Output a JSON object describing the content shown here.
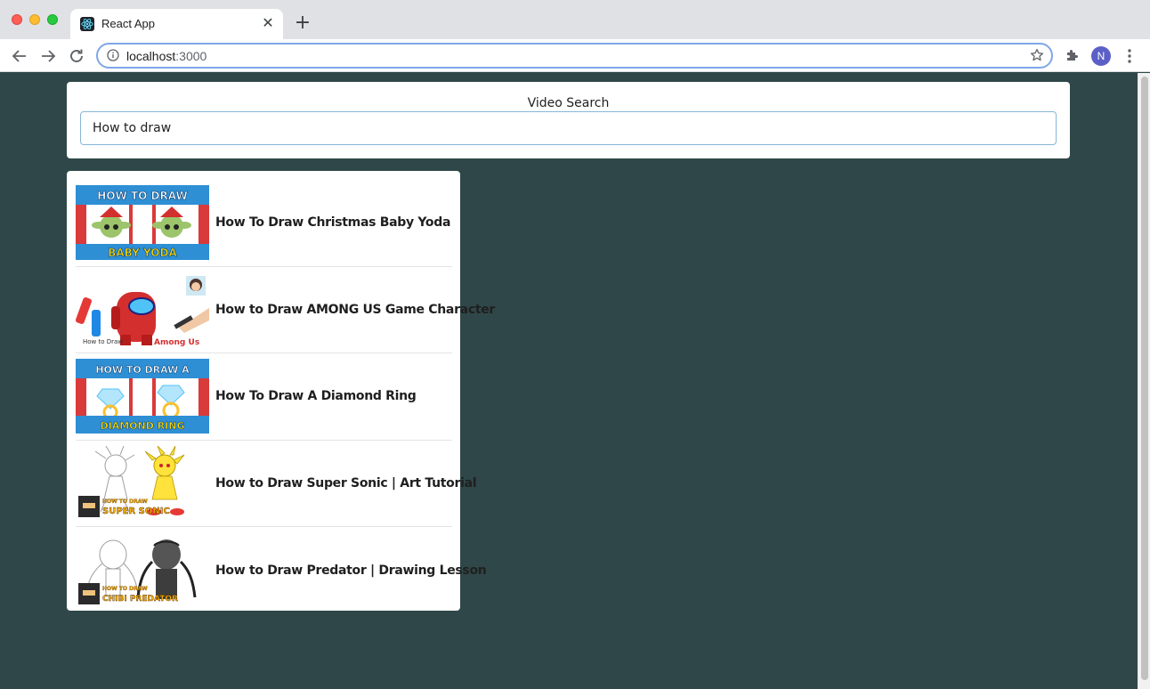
{
  "browser": {
    "tab_title": "React App",
    "tab_close": "✕",
    "new_tab": "+",
    "url_host": "localhost",
    "url_port": ":3000",
    "profile_initial": "N",
    "icons": [
      "react-favicon-icon",
      "back-arrow-icon",
      "forward-arrow-icon",
      "reload-icon",
      "info-icon",
      "star-icon",
      "puzzle-extension-icon",
      "kebab-menu-icon"
    ]
  },
  "search": {
    "label": "Video Search",
    "value": "How to draw"
  },
  "videos": [
    {
      "title": "How To Draw Christmas Baby Yoda",
      "thumbnail_text": "HOW TO DRAW BABY YODA"
    },
    {
      "title": "How to Draw AMONG US Game Character",
      "thumbnail_text": "How to Draw Among Us"
    },
    {
      "title": "How To Draw A Diamond Ring",
      "thumbnail_text": "HOW TO DRAW A DIAMOND RING"
    },
    {
      "title": "How to Draw Super Sonic | Art Tutorial",
      "thumbnail_text": "HOW TO DRAW SUPER SONIC"
    },
    {
      "title": "How to Draw Predator | Drawing Lesson",
      "thumbnail_text": "HOW TO DRAW CHIBI PREDATOR"
    }
  ],
  "colors": {
    "page_background": "#2f4748",
    "card_background": "#ffffff",
    "input_border": "#85b7d9",
    "omnibox_focus": "#7fa7e8"
  }
}
